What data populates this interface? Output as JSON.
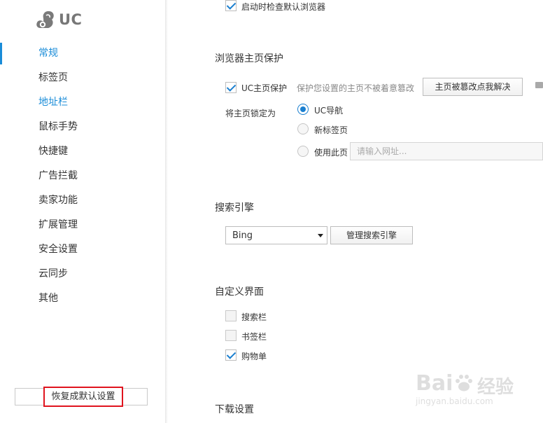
{
  "logo": {
    "text": "UC"
  },
  "sidebar": {
    "items": [
      {
        "label": "常规"
      },
      {
        "label": "标签页"
      },
      {
        "label": "地址栏"
      },
      {
        "label": "鼠标手势"
      },
      {
        "label": "快捷键"
      },
      {
        "label": "广告拦截"
      },
      {
        "label": "卖家功能"
      },
      {
        "label": "扩展管理"
      },
      {
        "label": "安全设置"
      },
      {
        "label": "云同步"
      },
      {
        "label": "其他"
      }
    ],
    "reset_label": "恢复成默认设置"
  },
  "startup": {
    "check_default_label": "启动时检查默认浏览器",
    "checked": true
  },
  "homepage_protect": {
    "title": "浏览器主页保护",
    "uc_protect_label": "UC主页保护",
    "uc_protect_checked": true,
    "hint": "保护您设置的主页不被着意篡改",
    "fix_button": "主页被篡改点我解决",
    "lock_label": "将主页锁定为",
    "options": [
      {
        "label": "UC导航",
        "selected": true
      },
      {
        "label": "新标签页",
        "selected": false
      },
      {
        "label": "使用此页",
        "selected": false
      }
    ],
    "url_placeholder": "请输入网址..."
  },
  "search_engine": {
    "title": "搜索引擎",
    "selected": "Bing",
    "manage_button": "管理搜索引擎"
  },
  "custom_ui": {
    "title": "自定义界面",
    "options": [
      {
        "label": "搜索栏",
        "checked": false
      },
      {
        "label": "书签栏",
        "checked": false
      },
      {
        "label": "购物单",
        "checked": true
      }
    ]
  },
  "download": {
    "title": "下载设置"
  },
  "watermark": {
    "brand": "Bai",
    "brand2": "经验",
    "url": "jingyan.baidu.com"
  },
  "colors": {
    "accent": "#1a8cd8",
    "highlight_border": "#e0141e"
  }
}
